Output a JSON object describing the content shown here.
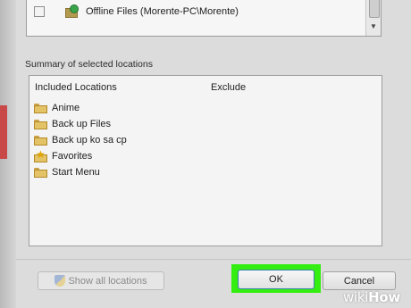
{
  "top_tree": {
    "item": {
      "label": "Offline Files (Morente-PC\\Morente)",
      "icon": "offline-files-icon",
      "checked": false
    }
  },
  "summary": {
    "label": "Summary of selected locations",
    "columns": {
      "included": "Included Locations",
      "exclude": "Exclude"
    },
    "items": [
      {
        "label": "Anime",
        "icon": "folder-icon"
      },
      {
        "label": "Back up Files",
        "icon": "folder-icon"
      },
      {
        "label": "Back up ko sa cp",
        "icon": "folder-icon"
      },
      {
        "label": "Favorites",
        "icon": "favorites-folder-icon"
      },
      {
        "label": "Start Menu",
        "icon": "folder-icon"
      }
    ]
  },
  "buttons": {
    "show_all": "Show all locations",
    "ok": "OK",
    "cancel": "Cancel"
  },
  "colors": {
    "highlight": "#33ee10"
  },
  "watermark": {
    "part1": "wiki",
    "part2": "How"
  }
}
